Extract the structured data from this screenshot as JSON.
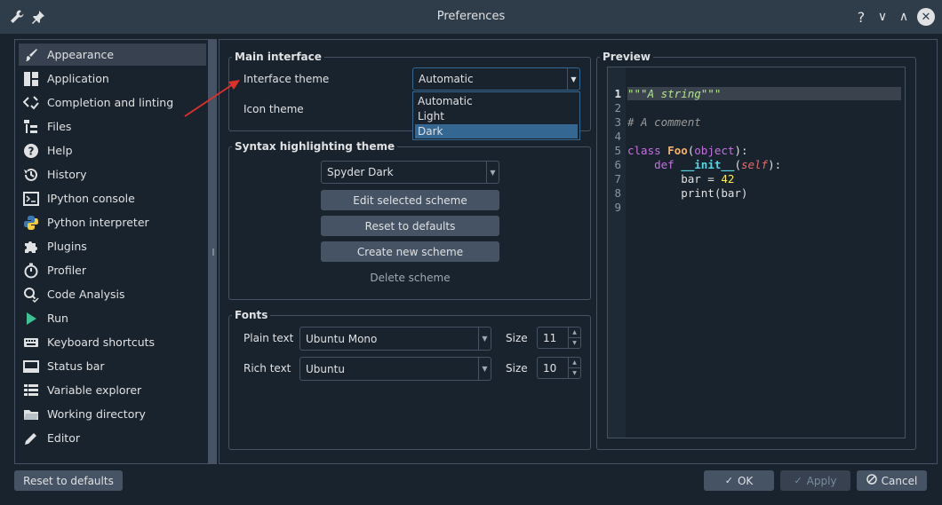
{
  "window": {
    "title": "Preferences",
    "icons": {
      "app": "wrench-icon",
      "pin": "pin-icon",
      "help": "?",
      "minimize": "∨",
      "maximize": "∧",
      "close": "✕"
    }
  },
  "nav": {
    "items": [
      {
        "label": "Appearance",
        "icon": "brush-icon",
        "selected": true
      },
      {
        "label": "Application",
        "icon": "layout-icon"
      },
      {
        "label": "Completion and linting",
        "icon": "code-check-icon"
      },
      {
        "label": "Files",
        "icon": "files-icon"
      },
      {
        "label": "Help",
        "icon": "help-icon"
      },
      {
        "label": "History",
        "icon": "history-icon"
      },
      {
        "label": "IPython console",
        "icon": "console-icon"
      },
      {
        "label": "Python interpreter",
        "icon": "python-icon"
      },
      {
        "label": "Plugins",
        "icon": "puzzle-icon"
      },
      {
        "label": "Profiler",
        "icon": "stopwatch-icon"
      },
      {
        "label": "Code Analysis",
        "icon": "magnifier-check-icon"
      },
      {
        "label": "Run",
        "icon": "play-icon"
      },
      {
        "label": "Keyboard shortcuts",
        "icon": "keyboard-icon"
      },
      {
        "label": "Status bar",
        "icon": "statusbar-icon"
      },
      {
        "label": "Variable explorer",
        "icon": "table-icon"
      },
      {
        "label": "Working directory",
        "icon": "folder-icon"
      },
      {
        "label": "Editor",
        "icon": "pencil-icon"
      }
    ]
  },
  "main_interface": {
    "title": "Main interface",
    "interface_theme_label": "Interface theme",
    "interface_theme_value": "Automatic",
    "icon_theme_label": "Icon theme",
    "dropdown_options": [
      "Automatic",
      "Light",
      "Dark"
    ],
    "dropdown_highlighted": "Dark"
  },
  "syntax": {
    "title": "Syntax highlighting theme",
    "scheme_value": "Spyder Dark",
    "edit_label": "Edit selected scheme",
    "reset_label": "Reset to defaults",
    "create_label": "Create new scheme",
    "delete_label": "Delete scheme"
  },
  "fonts": {
    "title": "Fonts",
    "plain_label": "Plain text",
    "plain_font": "Ubuntu Mono",
    "plain_size_label": "Size",
    "plain_size": "11",
    "rich_label": "Rich text",
    "rich_font": "Ubuntu",
    "rich_size_label": "Size",
    "rich_size": "10"
  },
  "preview": {
    "title": "Preview",
    "line_numbers": [
      "1",
      "2",
      "3",
      "4",
      "5",
      "6",
      "7",
      "8",
      "9"
    ]
  },
  "footer": {
    "reset_label": "Reset to defaults",
    "ok_label": "OK",
    "apply_label": "Apply",
    "cancel_label": "Cancel"
  },
  "colors": {
    "background": "#19232d",
    "titlebar": "#2f3d4b",
    "border": "#455364",
    "accent": "#346792",
    "arrow": "#e0302c"
  }
}
